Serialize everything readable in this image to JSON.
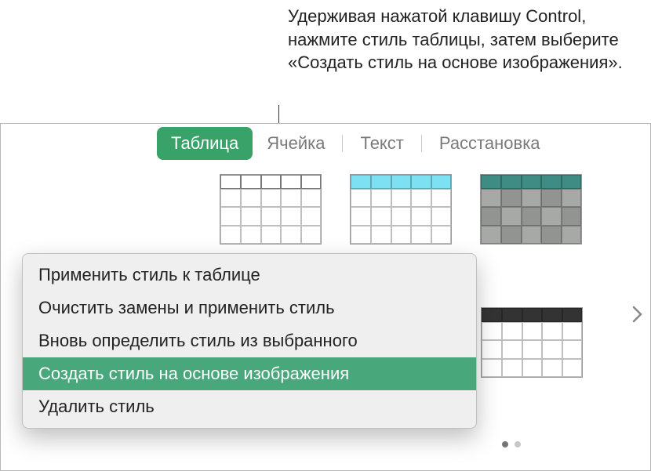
{
  "caption": "Удерживая нажатой клавишу Control, нажмите стиль таблицы, затем выберите «Создать стиль на основе изображения».",
  "tabs": {
    "table": "Таблица",
    "cell": "Ячейка",
    "text": "Текст",
    "arrange": "Расстановка"
  },
  "menu": {
    "apply": "Применить стиль к таблице",
    "clear": "Очистить замены и применить стиль",
    "redefine": "Вновь определить стиль из выбранного",
    "create": "Создать стиль на основе изображения",
    "delete": "Удалить стиль"
  },
  "colors": {
    "accent": "#39a268",
    "menuHighlight": "#48a77b"
  }
}
